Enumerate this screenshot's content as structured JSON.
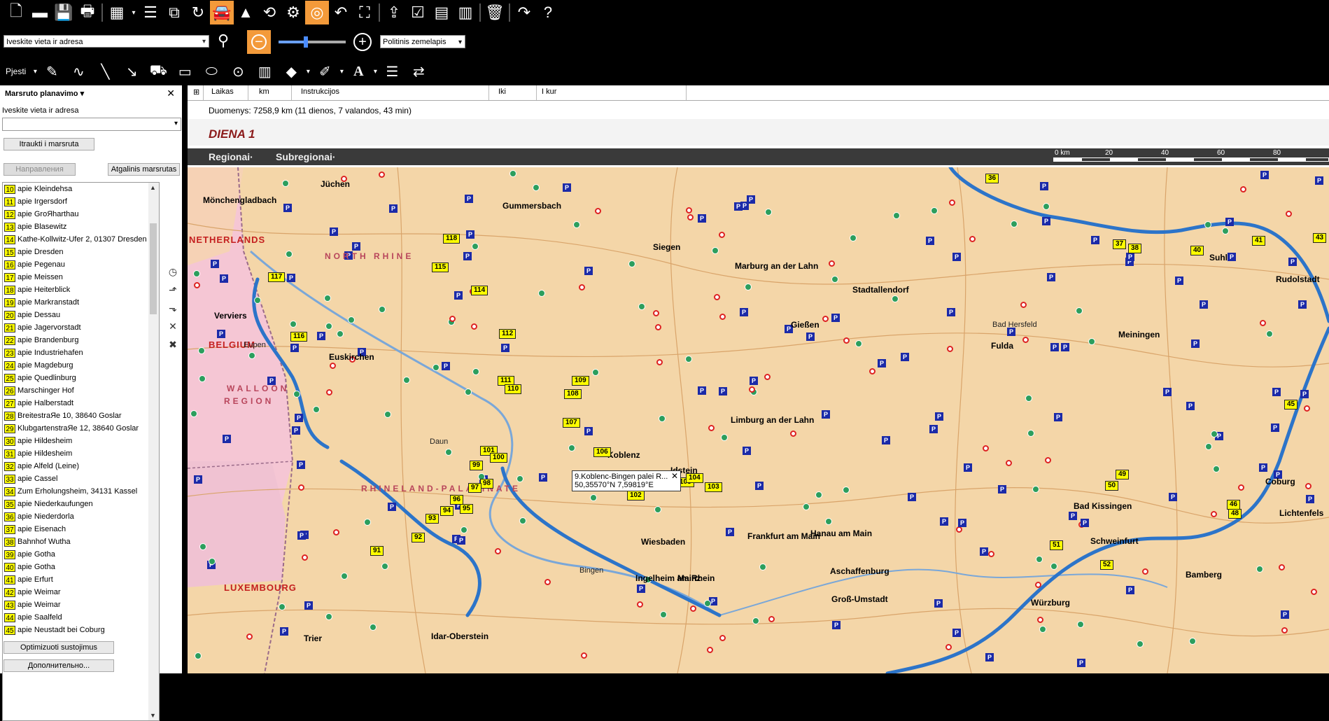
{
  "toolbar": {
    "icons": [
      "new-file-icon",
      "open-folder-icon",
      "save-icon",
      "print-icon",
      "map-view-icon",
      "menu-list-icon",
      "copy-icon",
      "route-arrow-icon",
      "car-icon",
      "navigate-arrow-icon",
      "route-search-icon",
      "gear-icon",
      "steering-wheel-icon",
      "undo-icon",
      "chart-icon",
      "export-icon",
      "checklist-icon",
      "book-map-icon",
      "document-icon",
      "trash-icon",
      "redo-icon",
      "help-icon"
    ]
  },
  "search": {
    "value": "Iveskite vieta ir adresa",
    "map_style": "Politinis zemelapis"
  },
  "draw": {
    "label": "Pjesti"
  },
  "sidebar": {
    "title": "Marsruto planavimo",
    "address_label": "Iveskite vieta ir adresa",
    "add_button": "Itraukti i marsruta",
    "directions_button": "Направления",
    "reverse_button": "Atgalinis marsrutas",
    "optimize_button": "Optimizuoti sustojimus",
    "more_button": "Дополнительно...",
    "stops": [
      {
        "n": "10",
        "label": "apie Kleindehsa"
      },
      {
        "n": "11",
        "label": "apie Irgersdorf"
      },
      {
        "n": "12",
        "label": "apie GroЯharthau"
      },
      {
        "n": "13",
        "label": "apie Blasewitz"
      },
      {
        "n": "14",
        "label": "Kathe-Kollwitz-Ufer 2, 01307 Dresden"
      },
      {
        "n": "15",
        "label": "apie Dresden"
      },
      {
        "n": "16",
        "label": "apie Pegenau"
      },
      {
        "n": "17",
        "label": "apie Meissen"
      },
      {
        "n": "18",
        "label": "apie Heiterblick"
      },
      {
        "n": "19",
        "label": "apie Markranstadt"
      },
      {
        "n": "20",
        "label": "apie Dessau"
      },
      {
        "n": "21",
        "label": "apie Jagervorstadt"
      },
      {
        "n": "22",
        "label": "apie Brandenburg"
      },
      {
        "n": "23",
        "label": "apie Industriehafen"
      },
      {
        "n": "24",
        "label": "apie Magdeburg"
      },
      {
        "n": "25",
        "label": "apie Quedlinburg"
      },
      {
        "n": "26",
        "label": "Marschinger Hof"
      },
      {
        "n": "27",
        "label": "apie Halberstadt"
      },
      {
        "n": "28",
        "label": "BreitestraЯe 10, 38640 Goslar"
      },
      {
        "n": "29",
        "label": "KlubgartenstraЯe 12, 38640 Goslar"
      },
      {
        "n": "30",
        "label": "apie Hildesheim"
      },
      {
        "n": "31",
        "label": "apie Hildesheim"
      },
      {
        "n": "32",
        "label": "apie Alfeld (Leine)"
      },
      {
        "n": "33",
        "label": "apie Cassel"
      },
      {
        "n": "34",
        "label": "Zum Erholungsheim, 34131 Kassel"
      },
      {
        "n": "35",
        "label": "apie Niederkaufungen"
      },
      {
        "n": "36",
        "label": "apie Niederdorla"
      },
      {
        "n": "37",
        "label": "apie Eisenach"
      },
      {
        "n": "38",
        "label": "Bahnhof Wutha"
      },
      {
        "n": "39",
        "label": "apie Gotha"
      },
      {
        "n": "40",
        "label": "apie Gotha"
      },
      {
        "n": "41",
        "label": "apie Erfurt"
      },
      {
        "n": "42",
        "label": "apie Weimar"
      },
      {
        "n": "43",
        "label": "apie Weimar"
      },
      {
        "n": "44",
        "label": "apie Saalfeld"
      },
      {
        "n": "45",
        "label": "apie Neustadt bei Coburg"
      }
    ]
  },
  "route_table": {
    "columns": [
      "Laikas",
      "km",
      "Instrukcijos",
      "Iki",
      "I kur"
    ],
    "summary": "Duomenys:  7258,9 km (11 dienos, 7 valandos, 43 min)",
    "day_title": "DIENA 1"
  },
  "map": {
    "tabs": [
      "Regionai·",
      "Subregionai·"
    ],
    "scale_labels": [
      "0 km",
      "20",
      "40",
      "60",
      "80"
    ],
    "popup_line1": "9.Koblenc-Bingen palei R...",
    "popup_line2": "50,35570°N 7,59819°E",
    "countries": [
      "NETHERLANDS",
      "BELGIUM",
      "LUXEMBOURG"
    ],
    "regions": [
      "WALLOON",
      "REGION",
      "RHINELAND-PALATINATE",
      "NORTH RHINE"
    ],
    "places": [
      {
        "t": "Jüchen"
      },
      {
        "t": "Mönchengladbach"
      },
      {
        "t": "Gummersbach"
      },
      {
        "t": "Siegen"
      },
      {
        "t": "Marburg an der Lahn"
      },
      {
        "t": "Fulda"
      },
      {
        "t": "Meiningen"
      },
      {
        "t": "Suhl"
      },
      {
        "t": "Rudolstadt"
      },
      {
        "t": "Koblenz"
      },
      {
        "t": "Limburg an der Lahn"
      },
      {
        "t": "Gießen"
      },
      {
        "t": "Wiesbaden"
      },
      {
        "t": "Mainz"
      },
      {
        "t": "Frankfurt am Main"
      },
      {
        "t": "Hanau am Main"
      },
      {
        "t": "Aschaffenburg"
      },
      {
        "t": "Würzburg"
      },
      {
        "t": "Bamberg"
      },
      {
        "t": "Schweinfurt"
      },
      {
        "t": "Bad Kissingen"
      },
      {
        "t": "Trier"
      },
      {
        "t": "Idar-Oberstein"
      },
      {
        "t": "Euskirchen"
      },
      {
        "t": "Daun"
      },
      {
        "t": "Verviers"
      },
      {
        "t": "Eupen"
      },
      {
        "t": "Ingelheim am Rhein"
      },
      {
        "t": "Bingen"
      },
      {
        "t": "Groß-Umstadt"
      },
      {
        "t": "Lichtenfels"
      },
      {
        "t": "Coburg"
      },
      {
        "t": "Stadtallendorf"
      },
      {
        "t": "Bad Hersfeld"
      },
      {
        "t": "Idstein"
      }
    ],
    "route_markers": [
      "117",
      "118",
      "115",
      "114",
      "116",
      "112",
      "111",
      "110",
      "109",
      "108",
      "107",
      "106",
      "105",
      "104",
      "103",
      "102",
      "101",
      "100",
      "99",
      "98",
      "97",
      "96",
      "95",
      "94",
      "93",
      "92",
      "91",
      "36",
      "37",
      "38",
      "40",
      "41",
      "43",
      "45",
      "46",
      "48",
      "49",
      "50",
      "51",
      "52"
    ]
  }
}
